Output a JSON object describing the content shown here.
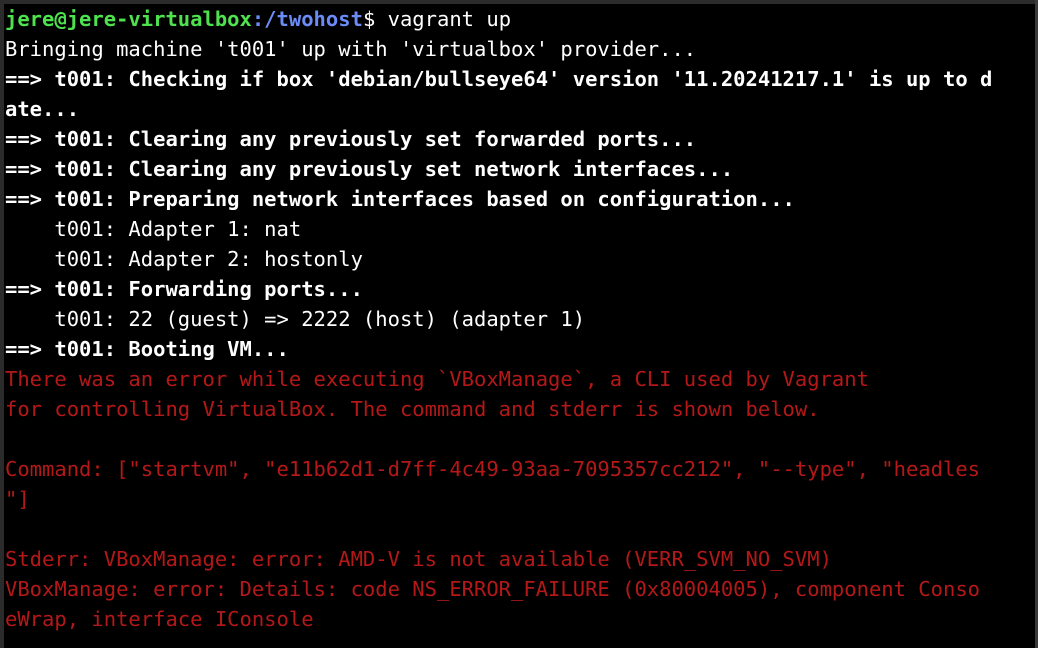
{
  "prompt": {
    "user_host": "jere@jere-virtualbox",
    "path": ":/twohost",
    "symbol": "$ ",
    "command": "vagrant up"
  },
  "lines": {
    "l1": "Bringing machine 't001' up with 'virtualbox' provider...",
    "l2": "==> t001: Checking if box 'debian/bullseye64' version '11.20241217.1' is up to d",
    "l3": "ate...",
    "l4": "==> t001: Clearing any previously set forwarded ports...",
    "l5": "==> t001: Clearing any previously set network interfaces...",
    "l6": "==> t001: Preparing network interfaces based on configuration...",
    "l7": "    t001: Adapter 1: nat",
    "l8": "    t001: Adapter 2: hostonly",
    "l9": "==> t001: Forwarding ports...",
    "l10": "    t001: 22 (guest) => 2222 (host) (adapter 1)",
    "l11": "==> t001: Booting VM...",
    "e1": "There was an error while executing `VBoxManage`, a CLI used by Vagrant",
    "e2": "for controlling VirtualBox. The command and stderr is shown below.",
    "e3": "",
    "e4": "Command: [\"startvm\", \"e11b62d1-d7ff-4c49-93aa-7095357cc212\", \"--type\", \"headles",
    "e5": "\"]",
    "e6": "",
    "e7": "Stderr: VBoxManage: error: AMD-V is not available (VERR_SVM_NO_SVM)",
    "e8": "VBoxManage: error: Details: code NS_ERROR_FAILURE (0x80004005), component Conso",
    "e9": "eWrap, interface IConsole"
  },
  "colors": {
    "background": "#000000",
    "prompt_user": "#4ee34e",
    "prompt_path": "#6b8cf7",
    "error_text": "#b41818",
    "normal_text": "#ffffff"
  }
}
